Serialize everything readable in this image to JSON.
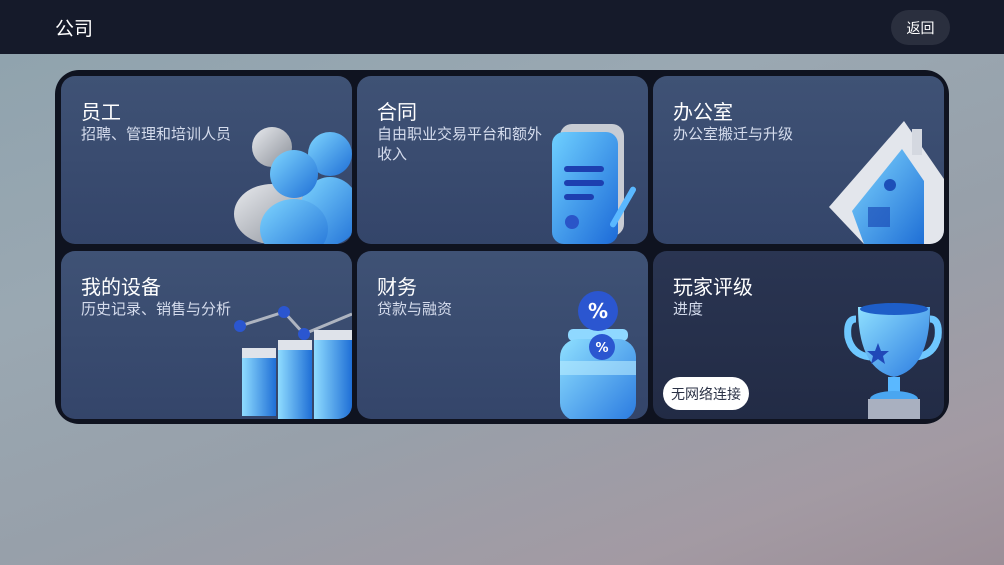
{
  "header": {
    "title": "公司",
    "back_label": "返回"
  },
  "cards": [
    {
      "title": "员工",
      "subtitle": "招聘、管理和培训人员"
    },
    {
      "title": "合同",
      "subtitle": "自由职业交易平台和额外收入"
    },
    {
      "title": "办公室",
      "subtitle": "办公室搬迁与升级"
    },
    {
      "title": "我的设备",
      "subtitle": "历史记录、销售与分析"
    },
    {
      "title": "财务",
      "subtitle": "贷款与融资"
    },
    {
      "title": "玩家评级",
      "subtitle": "进度",
      "badge": "无网络连接"
    }
  ],
  "colors": {
    "accent": "#3aa0ff",
    "topbar": "#151a2a",
    "card": "#3f5275"
  }
}
